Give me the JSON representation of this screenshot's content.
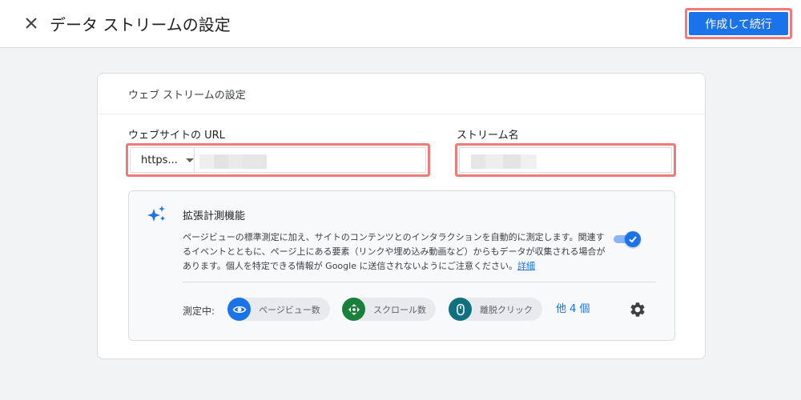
{
  "header": {
    "title": "データ ストリームの設定",
    "primary_button": "作成して続行"
  },
  "card": {
    "title": "ウェブ ストリームの設定",
    "url_field": {
      "label": "ウェブサイトの URL",
      "protocol": "https..."
    },
    "stream_name_field": {
      "label": "ストリーム名"
    },
    "enhanced_measurement": {
      "icon": "sparkle-icon",
      "title": "拡張計測機能",
      "description": "ページビューの標準測定に加え、サイトのコンテンツとのインタラクションを自動的に測定します。関連するイベントとともに、ページ上にある要素（リンクや埋め込み動画など）からもデータが収集される場合があります。個人を特定できる情報が Google に送信されないようにご注意ください。",
      "detail_link": "詳細",
      "toggle_on": true,
      "measuring_label": "測定中:",
      "chips": [
        {
          "label": "ページビュー数",
          "icon": "eye-icon",
          "color": "#1a73e8"
        },
        {
          "label": "スクロール数",
          "icon": "scroll-arrows-icon",
          "color": "#188038"
        },
        {
          "label": "離脱クリック",
          "icon": "mouse-icon",
          "color": "#12707e"
        }
      ],
      "more_link": "他 4 個"
    }
  },
  "colors": {
    "accent": "#1a73e8",
    "highlight": "#f07a78"
  }
}
